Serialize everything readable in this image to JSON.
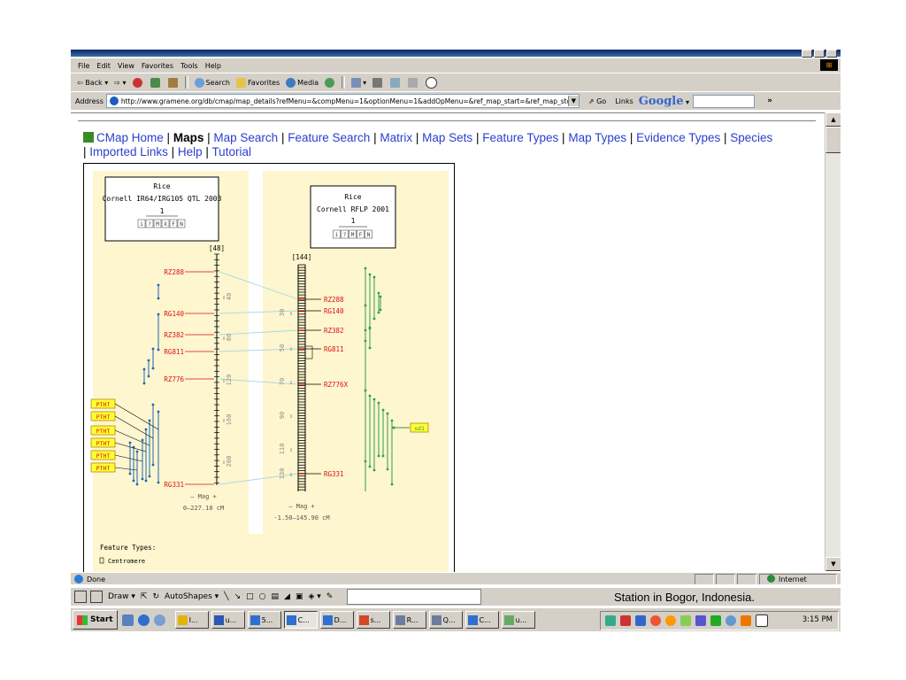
{
  "window": {
    "title": ""
  },
  "menu": [
    "File",
    "Edit",
    "View",
    "Favorites",
    "Tools",
    "Help"
  ],
  "toolbar": {
    "back": "Back",
    "search": "Search",
    "favorites": "Favorites",
    "media": "Media"
  },
  "address": {
    "label": "Address",
    "url": "http://www.gramene.org/db/cmap/map_details?refMenu=&compMenu=1&optionMenu=1&addOpMenu=&ref_map_start=&ref_map_sto",
    "go_label": "Go",
    "links_label": "Links",
    "google_label": "Google"
  },
  "nav": {
    "home": "CMap Home",
    "maps": "Maps",
    "map_search": "Map Search",
    "feature_search": "Feature Search",
    "matrix": "Matrix",
    "map_sets": "Map Sets",
    "feature_types": "Feature Types",
    "map_types": "Map Types",
    "evidence_types": "Evidence Types",
    "species": "Species",
    "imported_links": "Imported Links",
    "help": "Help",
    "tutorial": "Tutorial",
    "separator": "|"
  },
  "maps": {
    "left": {
      "species": "Rice",
      "map_set": "Cornell IR64/IRG105 QTL 2003",
      "map_name": "1",
      "buttons": [
        "i",
        "?",
        "M",
        "X",
        "F",
        "N"
      ],
      "count": "[48]",
      "mag_label": "– Mag +",
      "range": "0–227.10 cM",
      "scale_labels": [
        "40",
        "80",
        "120",
        "160",
        "200"
      ],
      "markers": [
        "RZ288",
        "RG140",
        "RZ382",
        "RG811",
        "RZ776",
        "RG331"
      ],
      "qtl_labels": [
        "PTHT",
        "PTHT",
        "PTHT",
        "PTHT",
        "PTHT",
        "PTHT"
      ]
    },
    "right": {
      "species": "Rice",
      "map_set": "Cornell RFLP 2001",
      "map_name": "1",
      "buttons": [
        "i",
        "?",
        "M",
        "F",
        "N"
      ],
      "count": "[144]",
      "mag_label": "– Mag +",
      "range": "-1.50–145.90 cM",
      "scale_labels": [
        "30",
        "50",
        "70",
        "90",
        "110",
        "130"
      ],
      "markers": [
        "RZ288",
        "RG140",
        "RZ382",
        "RG811",
        "RZ776X",
        "RG331"
      ],
      "gene_label": "sd1"
    },
    "feature_types_heading": "Feature Types:",
    "feature_type_item": "Centromere"
  },
  "colors": {
    "link": "#2a3fcf",
    "panel_bg": "#fdf6cf",
    "marker_red": "#dd1111",
    "qtl_blue": "#1f64b4",
    "qtl_green": "#2e9e4a",
    "corr_line": "#a8d8e0",
    "label_yellow": "#ffff33"
  },
  "status": {
    "text": "Done",
    "zone": "Internet"
  },
  "drawbar": {
    "draw": "Draw",
    "autoshapes": "AutoShapes",
    "slide_text": "Station in Bogor, Indonesia."
  },
  "taskbar": {
    "start": "Start",
    "tasks": [
      {
        "label": "I...",
        "icon": "presentation-icon"
      },
      {
        "label": "u...",
        "icon": "word-icon"
      },
      {
        "label": "5...",
        "icon": "ie-icon"
      },
      {
        "label": "C...",
        "icon": "ie-icon"
      },
      {
        "label": "D...",
        "icon": "ie-icon"
      },
      {
        "label": "s...",
        "icon": "powerpoint-icon"
      },
      {
        "label": "R...",
        "icon": "mail-icon"
      },
      {
        "label": "Q...",
        "icon": "mail-icon"
      },
      {
        "label": "C...",
        "icon": "ie-icon"
      },
      {
        "label": "u...",
        "icon": "app-icon"
      }
    ],
    "clock": "3:15 PM"
  }
}
